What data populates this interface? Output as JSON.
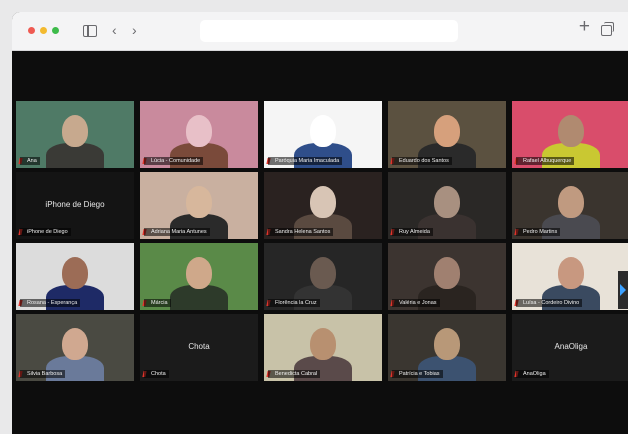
{
  "window": {
    "title": ""
  },
  "participants": [
    {
      "name": "Ana",
      "row": 0,
      "col": 0
    },
    {
      "name": "Lúcia - Comunidade",
      "row": 0,
      "col": 1
    },
    {
      "name": "Paróquia Maria Imaculada",
      "row": 0,
      "col": 2
    },
    {
      "name": "Eduardo dos Santos",
      "row": 0,
      "col": 3
    },
    {
      "name": "Rafael Albuquerque",
      "row": 0,
      "col": 4
    },
    {
      "name": "iPhone de Diego",
      "row": 1,
      "col": 0
    },
    {
      "name": "Adriana Maria Antunes",
      "row": 1,
      "col": 1
    },
    {
      "name": "Sandra Helena Santos",
      "row": 1,
      "col": 2
    },
    {
      "name": "Ruy Almeida",
      "row": 1,
      "col": 3
    },
    {
      "name": "Pedro Martins",
      "row": 1,
      "col": 4
    },
    {
      "name": "Rosana - Esperança",
      "row": 2,
      "col": 0
    },
    {
      "name": "Márcia",
      "row": 2,
      "col": 1
    },
    {
      "name": "Florência la Cruz",
      "row": 2,
      "col": 2
    },
    {
      "name": "Valéria e Jonas",
      "row": 2,
      "col": 3
    },
    {
      "name": "Luísa - Cordeiro Divino",
      "row": 2,
      "col": 4
    },
    {
      "name": "Silvia Barbosa",
      "row": 3,
      "col": 0
    },
    {
      "name": "Chota",
      "row": 3,
      "col": 1
    },
    {
      "name": "Benedicta Cabral",
      "row": 3,
      "col": 2
    },
    {
      "name": "Patrícia e Tobias",
      "row": 3,
      "col": 3
    },
    {
      "name": "AnaOliga",
      "row": 3,
      "col": 4
    }
  ],
  "colors": {
    "stage": "#0d0d0d",
    "mute": "#e0342b",
    "arrow": "#3aa0ff"
  }
}
